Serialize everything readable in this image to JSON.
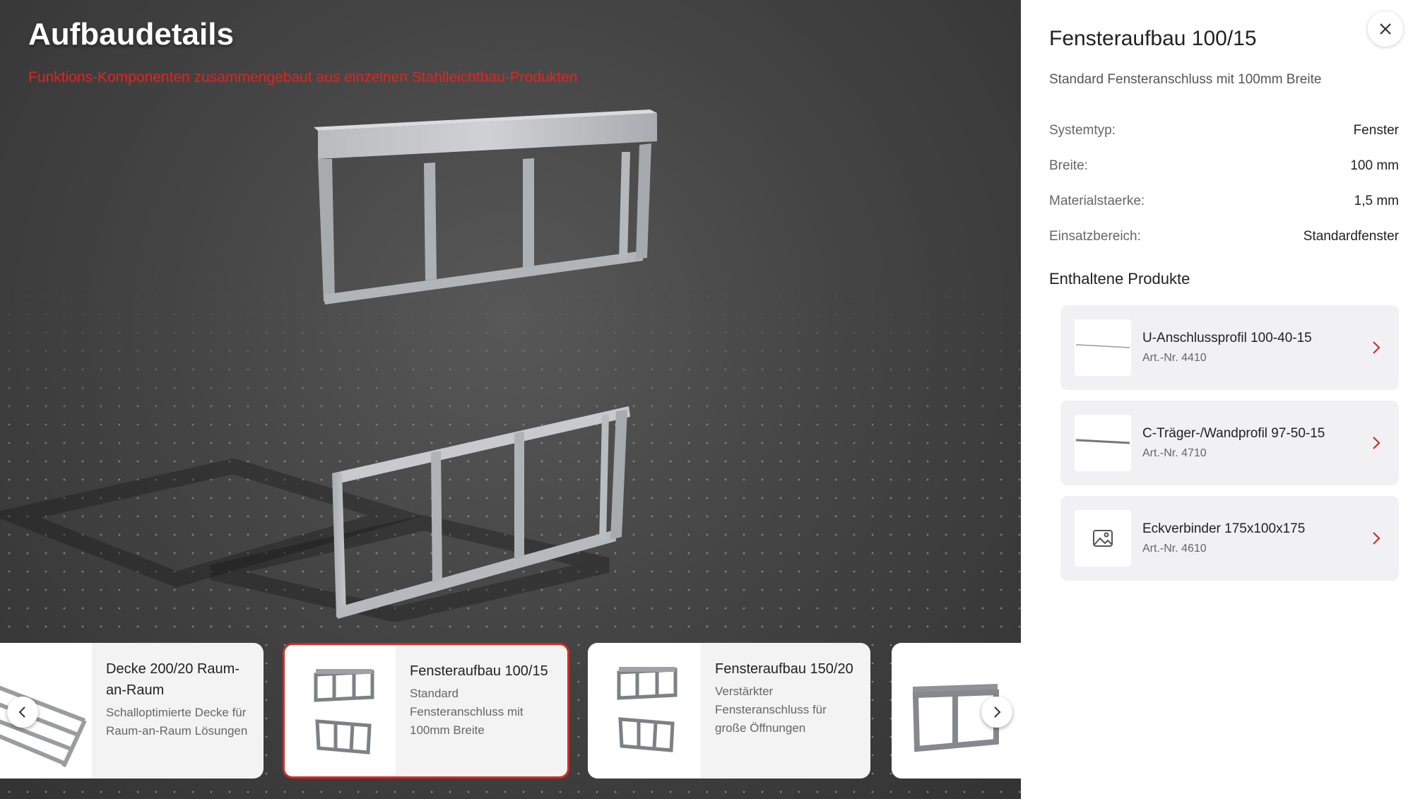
{
  "viewer": {
    "title": "Aufbaudetails",
    "subtitle": "Funktions-Komponenten zusammengebaut aus einzelnen Stahlleichtbau-Produkten"
  },
  "carousel": {
    "cards": [
      {
        "title": "Decke 200/20 Raum-an-Raum",
        "description": "Schalloptimierte Decke für Raum-an-Raum Lösungen"
      },
      {
        "title": "Fensteraufbau 100/15",
        "description": "Standard Fensteranschluss mit 100mm Breite"
      },
      {
        "title": "Fensteraufbau 150/20",
        "description": "Verstärkter Fensteranschluss für große Öffnungen"
      }
    ]
  },
  "panel": {
    "title": "Fensteraufbau 100/15",
    "subtitle": "Standard Fensteranschluss mit 100mm Breite",
    "specs": [
      {
        "label": "Systemtyp:",
        "value": "Fenster"
      },
      {
        "label": "Breite:",
        "value": "100 mm"
      },
      {
        "label": "Materialstaerke:",
        "value": "1,5 mm"
      },
      {
        "label": "Einsatzbereich:",
        "value": "Standardfenster"
      }
    ],
    "products_heading": "Enthaltene Produkte",
    "products": [
      {
        "name": "U-Anschlussprofil 100-40-15",
        "art": "Art.-Nr. 4410"
      },
      {
        "name": "C-Träger-/Wandprofil 97-50-15",
        "art": "Art.-Nr. 4710"
      },
      {
        "name": "Eckverbinder 175x100x175",
        "art": "Art.-Nr. 4610"
      }
    ]
  },
  "colors": {
    "accent": "#e5231e",
    "panel_bg": "#ffffff",
    "card_bg": "#f3f3f4"
  },
  "icons": [
    "close-icon",
    "chevron-left-icon",
    "chevron-right-icon",
    "image-placeholder-icon"
  ]
}
